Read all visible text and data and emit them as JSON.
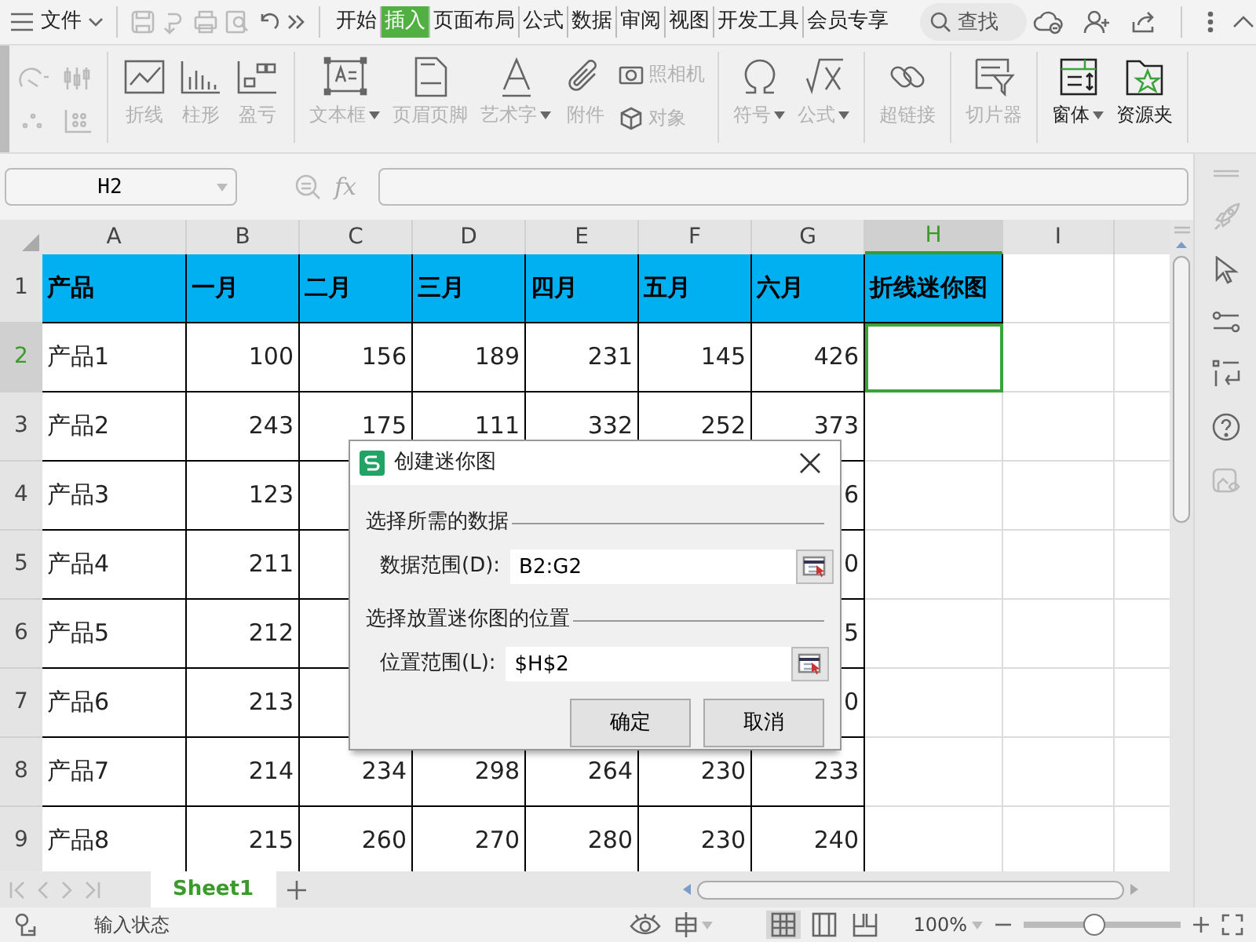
{
  "menu_bar": {
    "file_label": "文件",
    "tabs": [
      {
        "label": "开始",
        "selected": false
      },
      {
        "label": "插入",
        "selected": true
      },
      {
        "label": "页面布局",
        "selected": false
      },
      {
        "label": "公式",
        "selected": false
      },
      {
        "label": "数据",
        "selected": false
      },
      {
        "label": "审阅",
        "selected": false
      },
      {
        "label": "视图",
        "selected": false
      },
      {
        "label": "开发工具",
        "selected": false
      },
      {
        "label": "会员专享",
        "selected": false
      }
    ],
    "search": {
      "placeholder": "查找"
    }
  },
  "ribbon": {
    "groups": [
      {
        "items": [
          {
            "kind": "large",
            "label": "折线",
            "enabled": false,
            "dropdown": false
          },
          {
            "kind": "large",
            "label": "柱形",
            "enabled": false,
            "dropdown": false
          },
          {
            "kind": "large",
            "label": "盈亏",
            "enabled": false,
            "dropdown": false
          }
        ]
      },
      {
        "items": [
          {
            "kind": "large",
            "label": "文本框",
            "enabled": false,
            "dropdown": true
          },
          {
            "kind": "large",
            "label": "页眉页脚",
            "enabled": false,
            "dropdown": false
          },
          {
            "kind": "large",
            "label": "艺术字",
            "enabled": false,
            "dropdown": true
          },
          {
            "kind": "large",
            "label": "附件",
            "enabled": false,
            "dropdown": false
          },
          {
            "kind": "small",
            "label": "照相机",
            "enabled": false,
            "dropdown": false
          },
          {
            "kind": "small",
            "label": "对象",
            "enabled": false,
            "dropdown": false
          }
        ]
      },
      {
        "items": [
          {
            "kind": "large",
            "label": "符号",
            "enabled": false,
            "dropdown": true
          },
          {
            "kind": "large",
            "label": "公式",
            "enabled": false,
            "dropdown": true
          }
        ]
      },
      {
        "items": [
          {
            "kind": "large",
            "label": "超链接",
            "enabled": false,
            "dropdown": false
          }
        ]
      },
      {
        "items": [
          {
            "kind": "large",
            "label": "切片器",
            "enabled": false,
            "dropdown": false
          }
        ]
      },
      {
        "items": [
          {
            "kind": "large",
            "label": "窗体",
            "enabled": true,
            "dropdown": true
          },
          {
            "kind": "large",
            "label": "资源夹",
            "enabled": true,
            "dropdown": false
          }
        ]
      }
    ]
  },
  "formula_bar": {
    "name_box": "H2",
    "fx_label": "fx"
  },
  "sheet": {
    "columns": [
      {
        "label": "A",
        "selected": false
      },
      {
        "label": "B",
        "selected": false
      },
      {
        "label": "C",
        "selected": false
      },
      {
        "label": "D",
        "selected": false
      },
      {
        "label": "E",
        "selected": false
      },
      {
        "label": "F",
        "selected": false
      },
      {
        "label": "G",
        "selected": false
      },
      {
        "label": "H",
        "selected": true
      },
      {
        "label": "I",
        "selected": false
      }
    ],
    "rows": [
      {
        "label": "1",
        "selected": false,
        "kind": "header",
        "cells": [
          "产品",
          "一月",
          "二月",
          "三月",
          "四月",
          "五月",
          "六月",
          "折线迷你图"
        ]
      },
      {
        "label": "2",
        "selected": true,
        "kind": "data",
        "cells": [
          "产品1",
          "100",
          "156",
          "189",
          "231",
          "145",
          "426"
        ]
      },
      {
        "label": "3",
        "selected": false,
        "kind": "data",
        "cells": [
          "产品2",
          "243",
          "175",
          "111",
          "332",
          "252",
          "373"
        ]
      },
      {
        "label": "4",
        "selected": false,
        "kind": "data",
        "cells": [
          "产品3",
          "123"
        ],
        "end_cells": [
          "6"
        ]
      },
      {
        "label": "5",
        "selected": false,
        "kind": "data",
        "cells": [
          "产品4",
          "211"
        ],
        "end_cells": [
          "0"
        ]
      },
      {
        "label": "6",
        "selected": false,
        "kind": "data",
        "cells": [
          "产品5",
          "212"
        ],
        "end_cells": [
          "5"
        ]
      },
      {
        "label": "7",
        "selected": false,
        "kind": "data",
        "cells": [
          "产品6",
          "213"
        ],
        "end_cells": [
          "0"
        ]
      },
      {
        "label": "8",
        "selected": false,
        "kind": "data",
        "cells": [
          "产品7",
          "214",
          "234",
          "298",
          "264",
          "230",
          "233"
        ]
      },
      {
        "label": "9",
        "selected": false,
        "kind": "data",
        "cells": [
          "产品8",
          "215",
          "260",
          "270",
          "280",
          "230",
          "240"
        ]
      }
    ]
  },
  "sheet_tabs": [
    {
      "label": "Sheet1",
      "selected": true
    }
  ],
  "status_bar": {
    "mode": "输入状态",
    "zoom": "100%",
    "zoom_slider": {
      "level": 0.45
    }
  },
  "dialog": {
    "title": "创建迷你图",
    "sections": [
      {
        "heading": "选择所需的数据",
        "field_label": "数据范围(D):",
        "value": "B2:G2"
      },
      {
        "heading": "选择放置迷你图的位置",
        "field_label": "位置范围(L):",
        "value": "$H$2"
      }
    ],
    "buttons": [
      "确定",
      "取消"
    ]
  }
}
